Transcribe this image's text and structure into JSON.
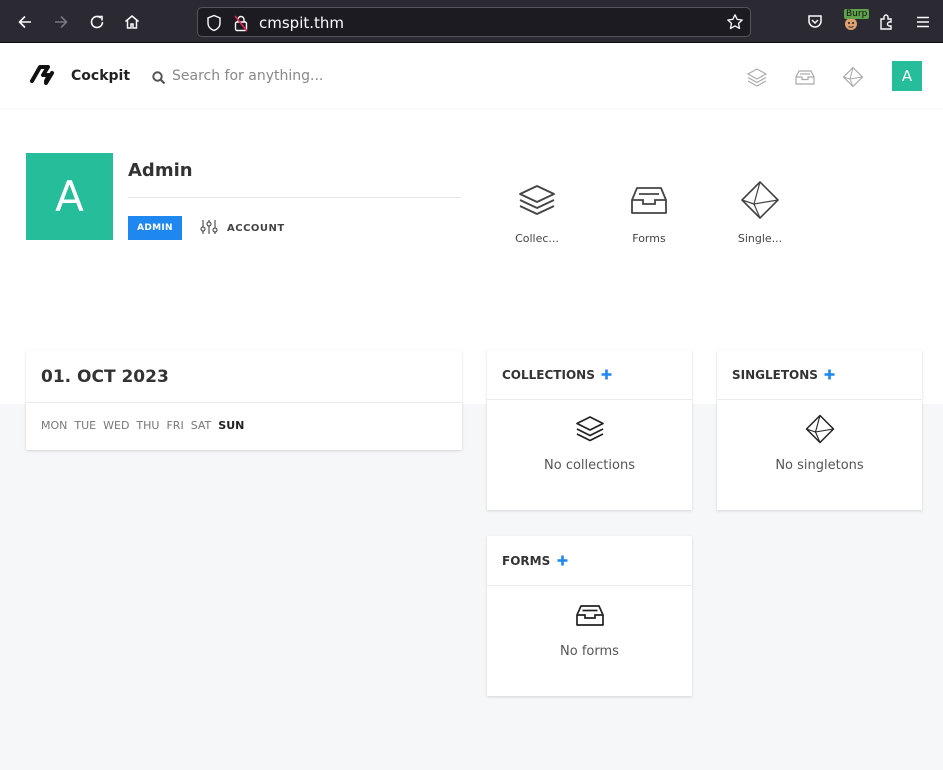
{
  "browser": {
    "url": "cmspit.thm",
    "burp_label": "Burp"
  },
  "header": {
    "brand": "Cockpit",
    "search_placeholder": "Search for anything...",
    "avatar_letter": "A"
  },
  "profile": {
    "avatar_letter": "A",
    "name": "Admin",
    "role": "ADMIN",
    "account_label": "ACCOUNT"
  },
  "modules": [
    {
      "label": "Collec...",
      "icon": "layers-icon"
    },
    {
      "label": "Forms",
      "icon": "inbox-icon"
    },
    {
      "label": "Single...",
      "icon": "diamond-icon"
    }
  ],
  "calendar": {
    "date": "01. OCT 2023",
    "days": [
      "MON",
      "TUE",
      "WED",
      "THU",
      "FRI",
      "SAT",
      "SUN"
    ],
    "today": "SUN"
  },
  "collections": {
    "title": "COLLECTIONS",
    "empty": "No collections"
  },
  "singletons": {
    "title": "SINGLETONS",
    "empty": "No singletons"
  },
  "forms": {
    "title": "FORMS",
    "empty": "No forms"
  },
  "colors": {
    "accent_teal": "#25bd9a",
    "primary_blue": "#1e87f0",
    "browser_dark": "#2b2a33"
  }
}
